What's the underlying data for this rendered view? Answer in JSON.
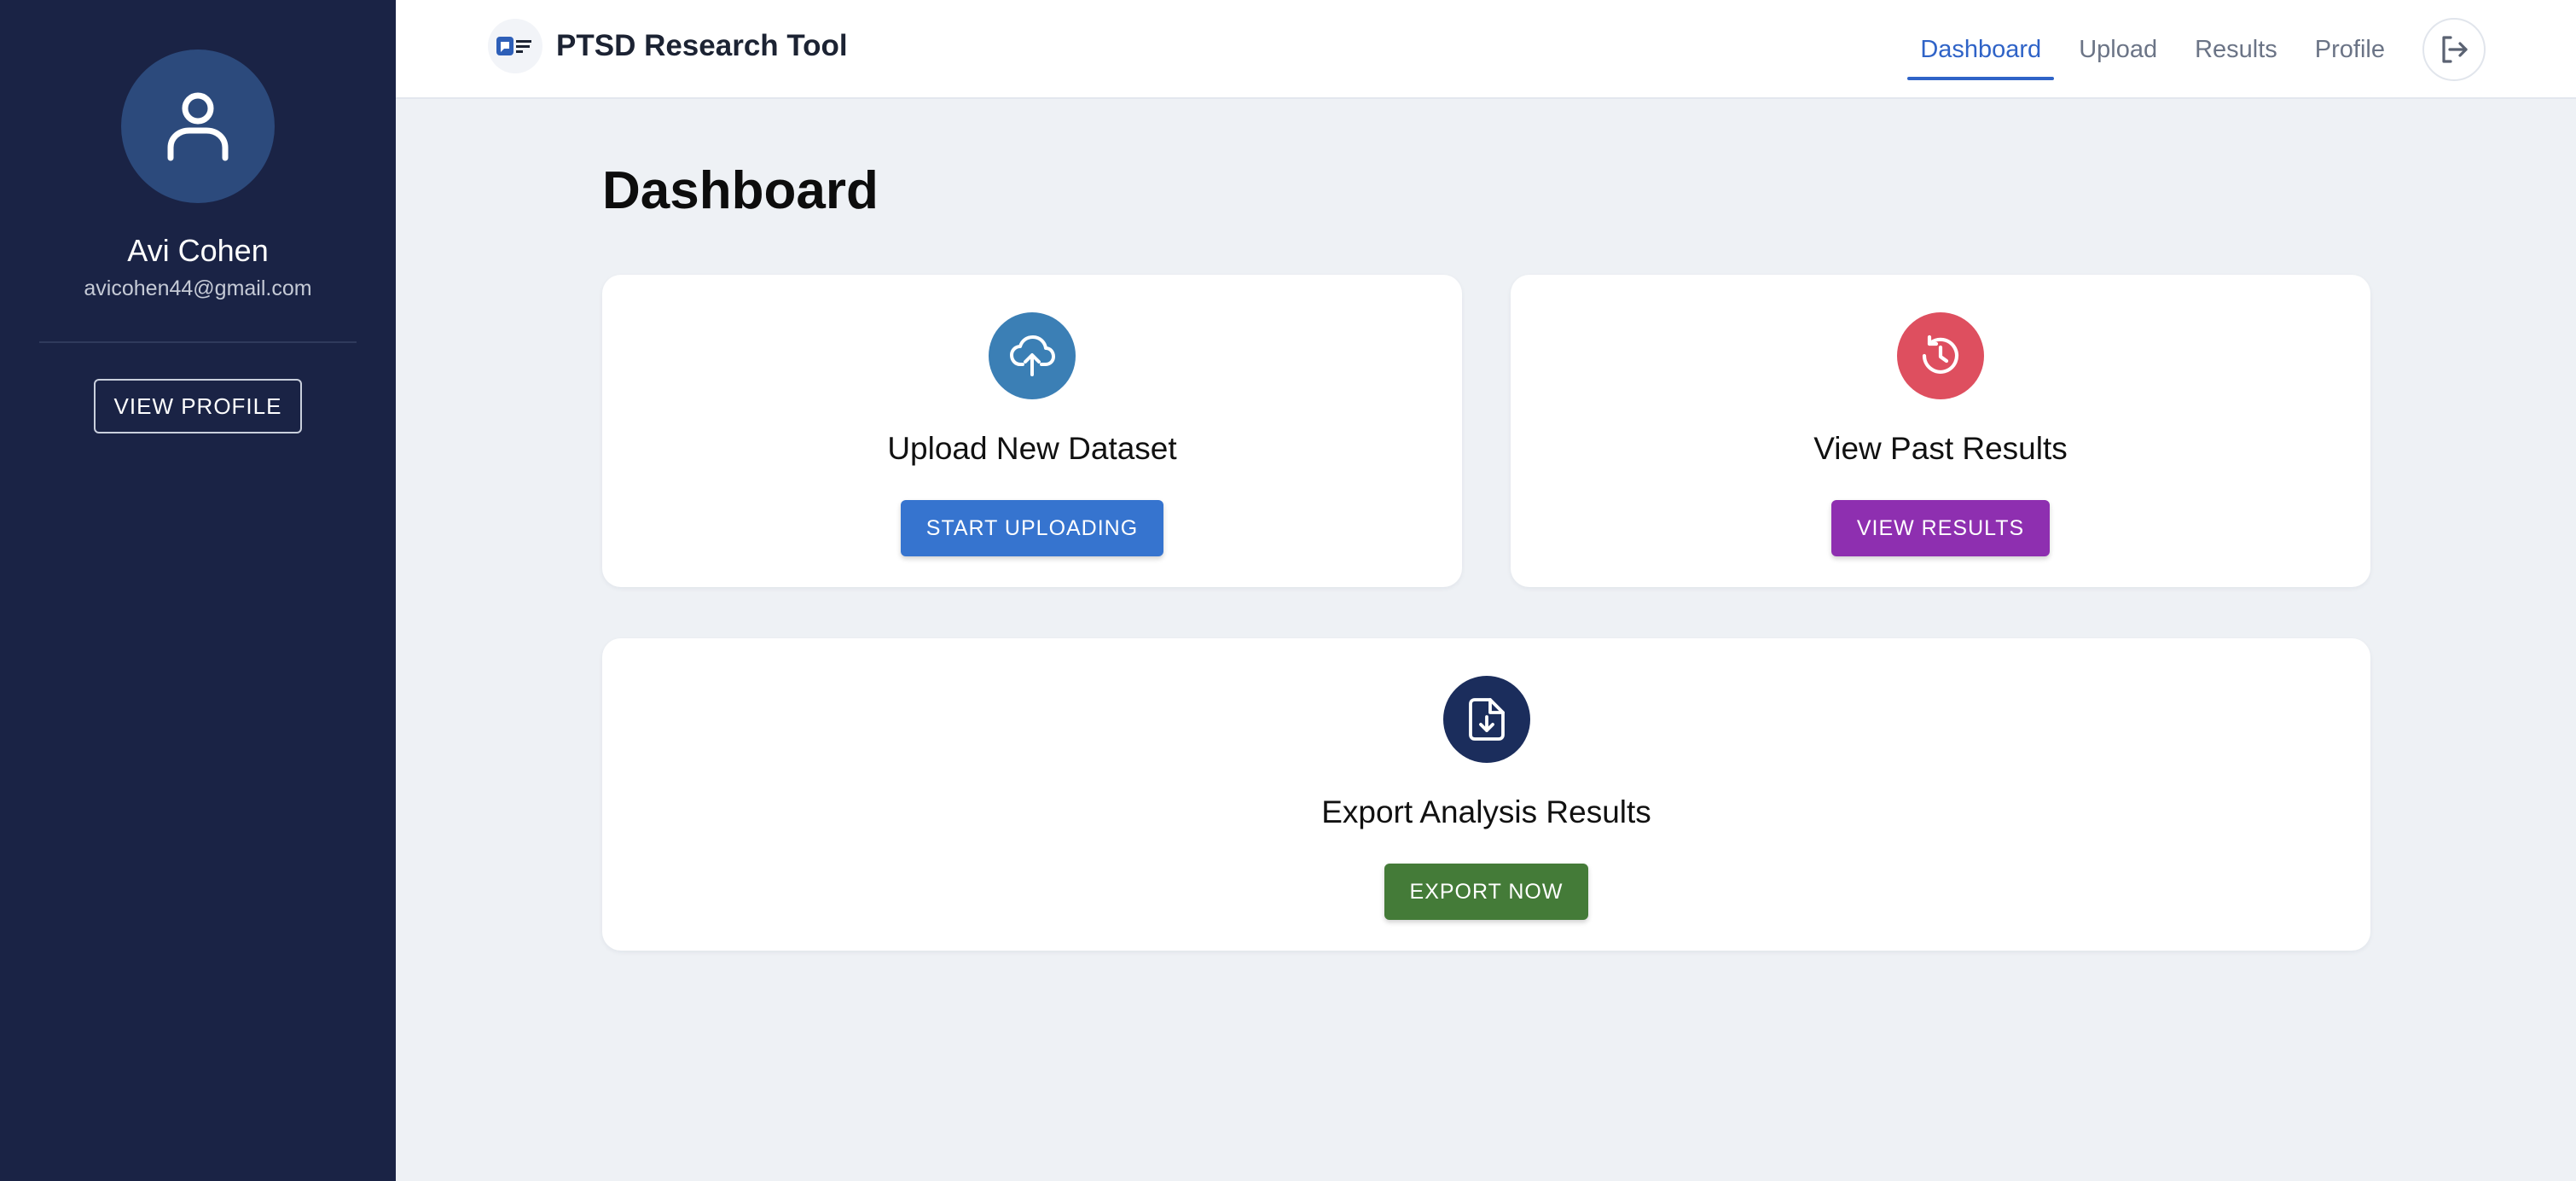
{
  "sidebar": {
    "user_name": "Avi Cohen",
    "user_email": "avicohen44@gmail.com",
    "view_profile_label": "VIEW PROFILE",
    "avatar_icon": "user-icon"
  },
  "header": {
    "app_title": "PTSD Research Tool",
    "nav": [
      {
        "label": "Dashboard",
        "active": true
      },
      {
        "label": "Upload",
        "active": false
      },
      {
        "label": "Results",
        "active": false
      },
      {
        "label": "Profile",
        "active": false
      }
    ],
    "logout_icon": "logout-icon"
  },
  "main": {
    "title": "Dashboard",
    "cards": [
      {
        "title": "Upload New Dataset",
        "button_label": "START UPLOADING",
        "icon": "cloud-upload-icon",
        "icon_color": "#3b7fb5",
        "button_color": "#3674cf"
      },
      {
        "title": "View Past Results",
        "button_label": "VIEW RESULTS",
        "icon": "history-icon",
        "icon_color": "#de4f5f",
        "button_color": "#8e2fb0"
      },
      {
        "title": "Export Analysis Results",
        "button_label": "EXPORT NOW",
        "icon": "file-download-icon",
        "icon_color": "#1b2d5c",
        "button_color": "#447b38"
      }
    ]
  },
  "colors": {
    "sidebar_bg": "#1a2345",
    "accent": "#2f63c7",
    "page_bg": "#eef1f5"
  }
}
